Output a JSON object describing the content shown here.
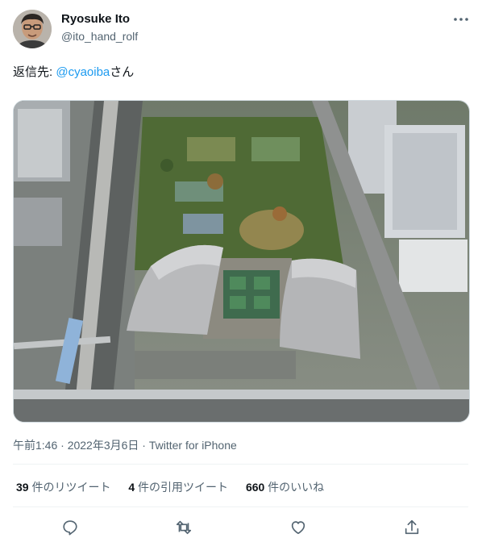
{
  "author": {
    "name": "Ryosuke Ito",
    "handle": "@ito_hand_rolf"
  },
  "reply": {
    "prefix": "返信先: ",
    "mention": "@cyaoiba",
    "suffix": "さん"
  },
  "media": {
    "icon": "aerial-photo-stadium"
  },
  "meta": {
    "timestamp": "午前1:46 · 2022年3月6日 · Twitter for iPhone"
  },
  "stats": {
    "retweets_count": "39",
    "retweets_label": " 件のリツイート",
    "quotes_count": "4",
    "quotes_label": " 件の引用ツイート",
    "likes_count": "660",
    "likes_label": " 件のいいね"
  },
  "actions": {
    "reply_icon": "reply-icon",
    "retweet_icon": "retweet-icon",
    "like_icon": "heart-icon",
    "share_icon": "share-icon"
  },
  "colors": {
    "accent": "#1d9bf0",
    "secondary_text": "#536471",
    "primary_text": "#0f1419"
  }
}
